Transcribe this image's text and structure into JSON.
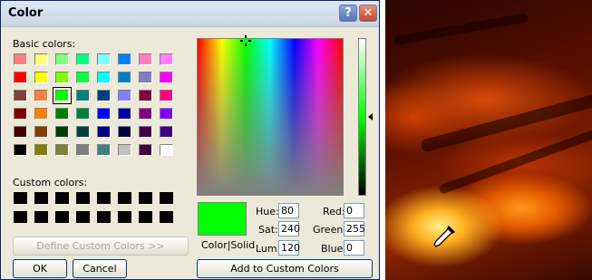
{
  "dialog": {
    "title": "Color",
    "help_glyph": "?",
    "close_glyph": "✕"
  },
  "labels": {
    "basic_colors": "Basic colors:",
    "custom_colors": "Custom colors:",
    "color_solid": "Color|Solid"
  },
  "basic_colors": [
    "#ff8080",
    "#ffff80",
    "#80ff80",
    "#00ff80",
    "#80ffff",
    "#0080ff",
    "#ff80c0",
    "#ff80ff",
    "#ff0000",
    "#ffff00",
    "#80ff00",
    "#00ff40",
    "#00ffff",
    "#0080c0",
    "#8080c0",
    "#ff00ff",
    "#804040",
    "#ff8040",
    "#00ff00",
    "#008080",
    "#004080",
    "#8080ff",
    "#800040",
    "#ff0080",
    "#800000",
    "#ff8000",
    "#008000",
    "#008040",
    "#0000ff",
    "#0000a0",
    "#800080",
    "#8000ff",
    "#400000",
    "#804000",
    "#004000",
    "#004040",
    "#000080",
    "#000040",
    "#400040",
    "#400080",
    "#000000",
    "#808000",
    "#808040",
    "#808080",
    "#408080",
    "#c0c0c0",
    "#400040",
    "#ffffff"
  ],
  "selected_basic_index": 18,
  "custom_colors": [
    "#000000",
    "#000000",
    "#000000",
    "#000000",
    "#000000",
    "#000000",
    "#000000",
    "#000000",
    "#000000",
    "#000000",
    "#000000",
    "#000000",
    "#000000",
    "#000000",
    "#000000",
    "#000000"
  ],
  "buttons": {
    "define_custom": "Define Custom Colors >>",
    "ok": "OK",
    "cancel": "Cancel",
    "add_custom": "Add to Custom Colors"
  },
  "fields": {
    "hue_label": "Hue:",
    "hue": "80",
    "sat_label": "Sat:",
    "sat": "240",
    "lum_label": "Lum:",
    "lum": "120",
    "red_label": "Red:",
    "red": "0",
    "green_label": "Green:",
    "green": "255",
    "blue_label": "Blue:",
    "blue": "0"
  },
  "current_color": "#00ff00"
}
